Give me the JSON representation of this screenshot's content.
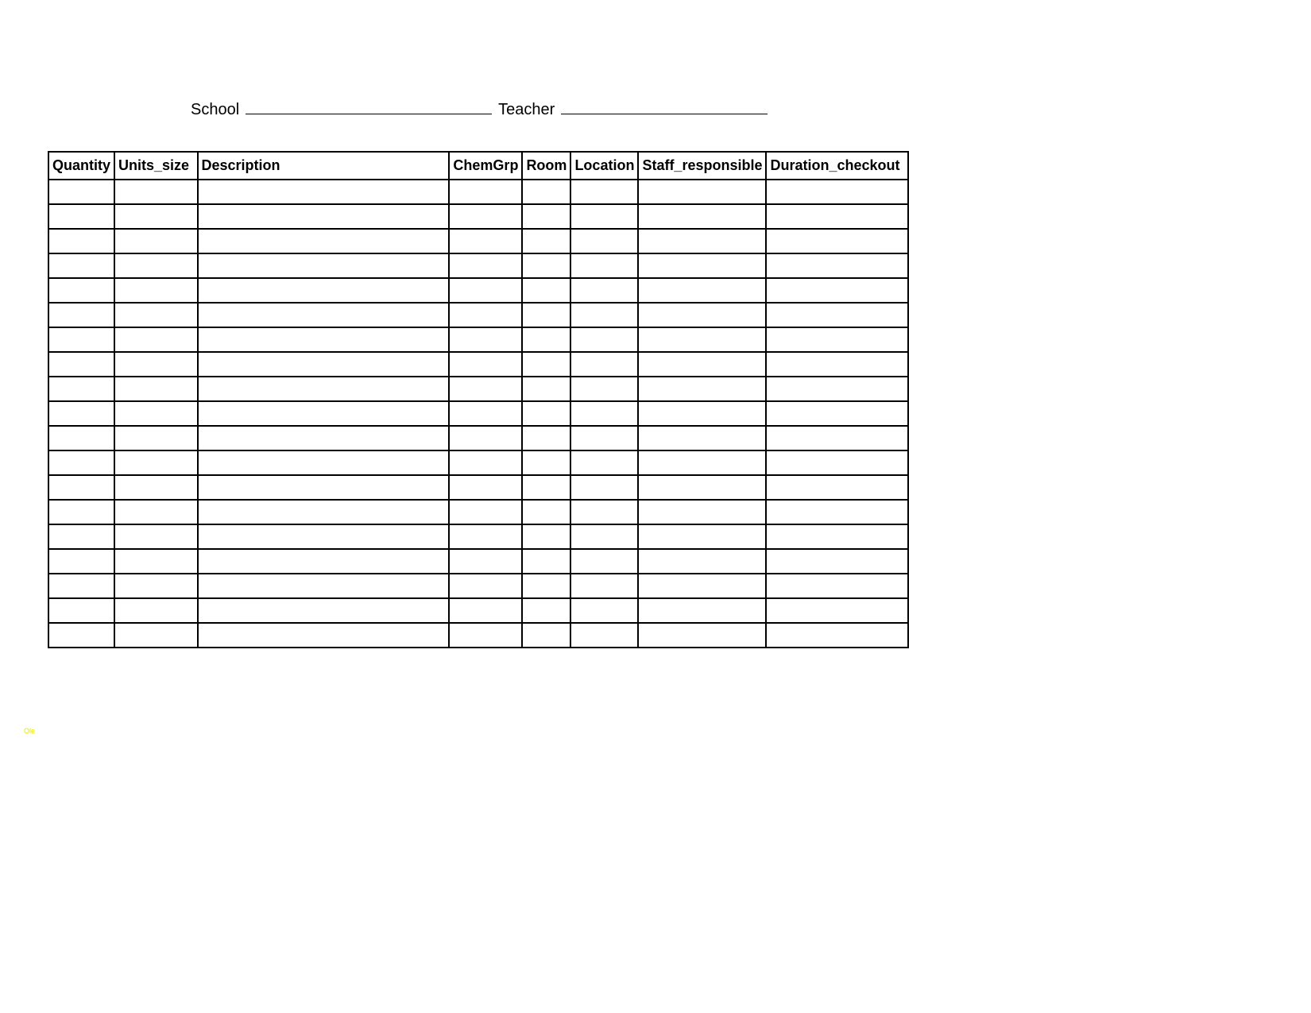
{
  "header": {
    "school_label": "School",
    "teacher_label": "Teacher"
  },
  "table": {
    "headers": [
      "Quantity",
      "Units_size",
      "Description",
      "ChemGrp",
      "Room",
      "Location",
      "Staff_responsible",
      "Duration_checkout"
    ],
    "row_count": 19,
    "rows": [
      {
        "quantity": "",
        "units": "",
        "desc": "",
        "chemgrp": "",
        "room": "",
        "location": "",
        "staff": "",
        "duration": ""
      },
      {
        "quantity": "",
        "units": "",
        "desc": "",
        "chemgrp": "",
        "room": "",
        "location": "",
        "staff": "",
        "duration": ""
      },
      {
        "quantity": "",
        "units": "",
        "desc": "",
        "chemgrp": "",
        "room": "",
        "location": "",
        "staff": "",
        "duration": ""
      },
      {
        "quantity": "",
        "units": "",
        "desc": "",
        "chemgrp": "",
        "room": "",
        "location": "",
        "staff": "",
        "duration": ""
      },
      {
        "quantity": "",
        "units": "",
        "desc": "",
        "chemgrp": "",
        "room": "",
        "location": "",
        "staff": "",
        "duration": ""
      },
      {
        "quantity": "",
        "units": "",
        "desc": "",
        "chemgrp": "",
        "room": "",
        "location": "",
        "staff": "",
        "duration": ""
      },
      {
        "quantity": "",
        "units": "",
        "desc": "",
        "chemgrp": "",
        "room": "",
        "location": "",
        "staff": "",
        "duration": ""
      },
      {
        "quantity": "",
        "units": "",
        "desc": "",
        "chemgrp": "",
        "room": "",
        "location": "",
        "staff": "",
        "duration": ""
      },
      {
        "quantity": "",
        "units": "",
        "desc": "",
        "chemgrp": "",
        "room": "",
        "location": "",
        "staff": "",
        "duration": ""
      },
      {
        "quantity": "",
        "units": "",
        "desc": "",
        "chemgrp": "",
        "room": "",
        "location": "",
        "staff": "",
        "duration": ""
      },
      {
        "quantity": "",
        "units": "",
        "desc": "",
        "chemgrp": "",
        "room": "",
        "location": "",
        "staff": "",
        "duration": ""
      },
      {
        "quantity": "",
        "units": "",
        "desc": "",
        "chemgrp": "",
        "room": "",
        "location": "",
        "staff": "",
        "duration": ""
      },
      {
        "quantity": "",
        "units": "",
        "desc": "",
        "chemgrp": "",
        "room": "",
        "location": "",
        "staff": "",
        "duration": ""
      },
      {
        "quantity": "",
        "units": "",
        "desc": "",
        "chemgrp": "",
        "room": "",
        "location": "",
        "staff": "",
        "duration": ""
      },
      {
        "quantity": "",
        "units": "",
        "desc": "",
        "chemgrp": "",
        "room": "",
        "location": "",
        "staff": "",
        "duration": ""
      },
      {
        "quantity": "",
        "units": "",
        "desc": "",
        "chemgrp": "",
        "room": "",
        "location": "",
        "staff": "",
        "duration": ""
      },
      {
        "quantity": "",
        "units": "",
        "desc": "",
        "chemgrp": "",
        "room": "",
        "location": "",
        "staff": "",
        "duration": ""
      },
      {
        "quantity": "",
        "units": "",
        "desc": "",
        "chemgrp": "",
        "room": "",
        "location": "",
        "staff": "",
        "duration": ""
      },
      {
        "quantity": "",
        "units": "",
        "desc": "",
        "chemgrp": "",
        "room": "",
        "location": "",
        "staff": "",
        "duration": ""
      }
    ]
  },
  "watermark": "Ole"
}
